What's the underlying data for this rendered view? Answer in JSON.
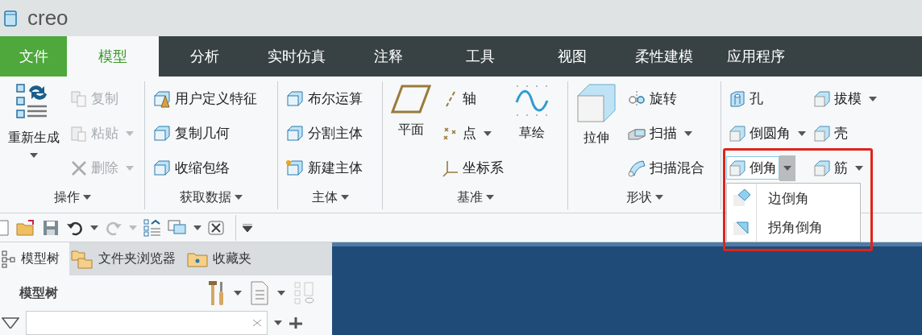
{
  "app": {
    "logo": "creo"
  },
  "tabs": [
    {
      "label": "文件",
      "kind": "file",
      "selected": false
    },
    {
      "label": "模型",
      "kind": "tab",
      "selected": true
    },
    {
      "label": "分析",
      "kind": "tab",
      "selected": false
    },
    {
      "label": "实时仿真",
      "kind": "tab",
      "selected": false
    },
    {
      "label": "注释",
      "kind": "tab",
      "selected": false
    },
    {
      "label": "工具",
      "kind": "tab",
      "selected": false
    },
    {
      "label": "视图",
      "kind": "tab",
      "selected": false
    },
    {
      "label": "柔性建模",
      "kind": "tab",
      "selected": false
    },
    {
      "label": "应用程序",
      "kind": "tab",
      "selected": false
    }
  ],
  "ribbon_groups": [
    {
      "label": "操作",
      "columns": [
        {
          "kind": "large",
          "label": "重新生成",
          "menu": true
        },
        {
          "kind": "stack",
          "items": [
            {
              "label": "复制",
              "disabled": true,
              "menu": false
            },
            {
              "label": "粘贴",
              "disabled": true,
              "menu": true
            },
            {
              "label": "删除",
              "disabled": true,
              "menu": true
            }
          ]
        }
      ]
    },
    {
      "label": "获取数据",
      "columns": [
        {
          "kind": "stack",
          "items": [
            {
              "label": "用户定义特征",
              "disabled": false,
              "menu": false
            },
            {
              "label": "复制几何",
              "disabled": false,
              "menu": false
            },
            {
              "label": "收缩包络",
              "disabled": false,
              "menu": false
            }
          ]
        }
      ]
    },
    {
      "label": "主体",
      "columns": [
        {
          "kind": "stack",
          "items": [
            {
              "label": "布尔运算",
              "disabled": false,
              "menu": false
            },
            {
              "label": "分割主体",
              "disabled": false,
              "menu": false
            },
            {
              "label": "新建主体",
              "disabled": false,
              "menu": false
            }
          ]
        }
      ]
    },
    {
      "label": "基准",
      "columns": [
        {
          "kind": "large",
          "label": "平面",
          "menu": false
        },
        {
          "kind": "stack",
          "items": [
            {
              "label": "轴",
              "disabled": false,
              "menu": false
            },
            {
              "label": "点",
              "disabled": false,
              "menu": true
            },
            {
              "label": "坐标系",
              "disabled": false,
              "menu": false
            }
          ]
        },
        {
          "kind": "large",
          "label": "草绘",
          "menu": false
        }
      ]
    },
    {
      "label": "形状",
      "columns": [
        {
          "kind": "large",
          "label": "拉伸",
          "menu": false
        },
        {
          "kind": "stack",
          "items": [
            {
              "label": "旋转",
              "disabled": false,
              "menu": false
            },
            {
              "label": "扫描",
              "disabled": false,
              "menu": true
            },
            {
              "label": "扫描混合",
              "disabled": false,
              "menu": false
            }
          ]
        }
      ]
    },
    {
      "columns": [
        {
          "kind": "stack",
          "items": [
            {
              "label": "孔",
              "disabled": false,
              "menu": false
            },
            {
              "label": "倒圆角",
              "disabled": false,
              "menu": true
            },
            {
              "label": "倒角",
              "disabled": false,
              "menu": true,
              "submenu": [
                {
                  "label": "边倒角"
                },
                {
                  "label": "拐角倒角"
                }
              ]
            }
          ]
        },
        {
          "kind": "stack",
          "items": [
            {
              "label": "拔模",
              "disabled": false,
              "menu": true
            },
            {
              "label": "壳",
              "disabled": false,
              "menu": false
            },
            {
              "label": "筋",
              "disabled": false,
              "menu": true
            }
          ]
        }
      ]
    }
  ],
  "panel": {
    "tabs": [
      {
        "label": "模型树",
        "selected": true
      },
      {
        "label": "文件夹浏览器",
        "selected": false
      },
      {
        "label": "收藏夹",
        "selected": false
      }
    ],
    "title": "模型树"
  },
  "highlight": {
    "shown": true
  }
}
